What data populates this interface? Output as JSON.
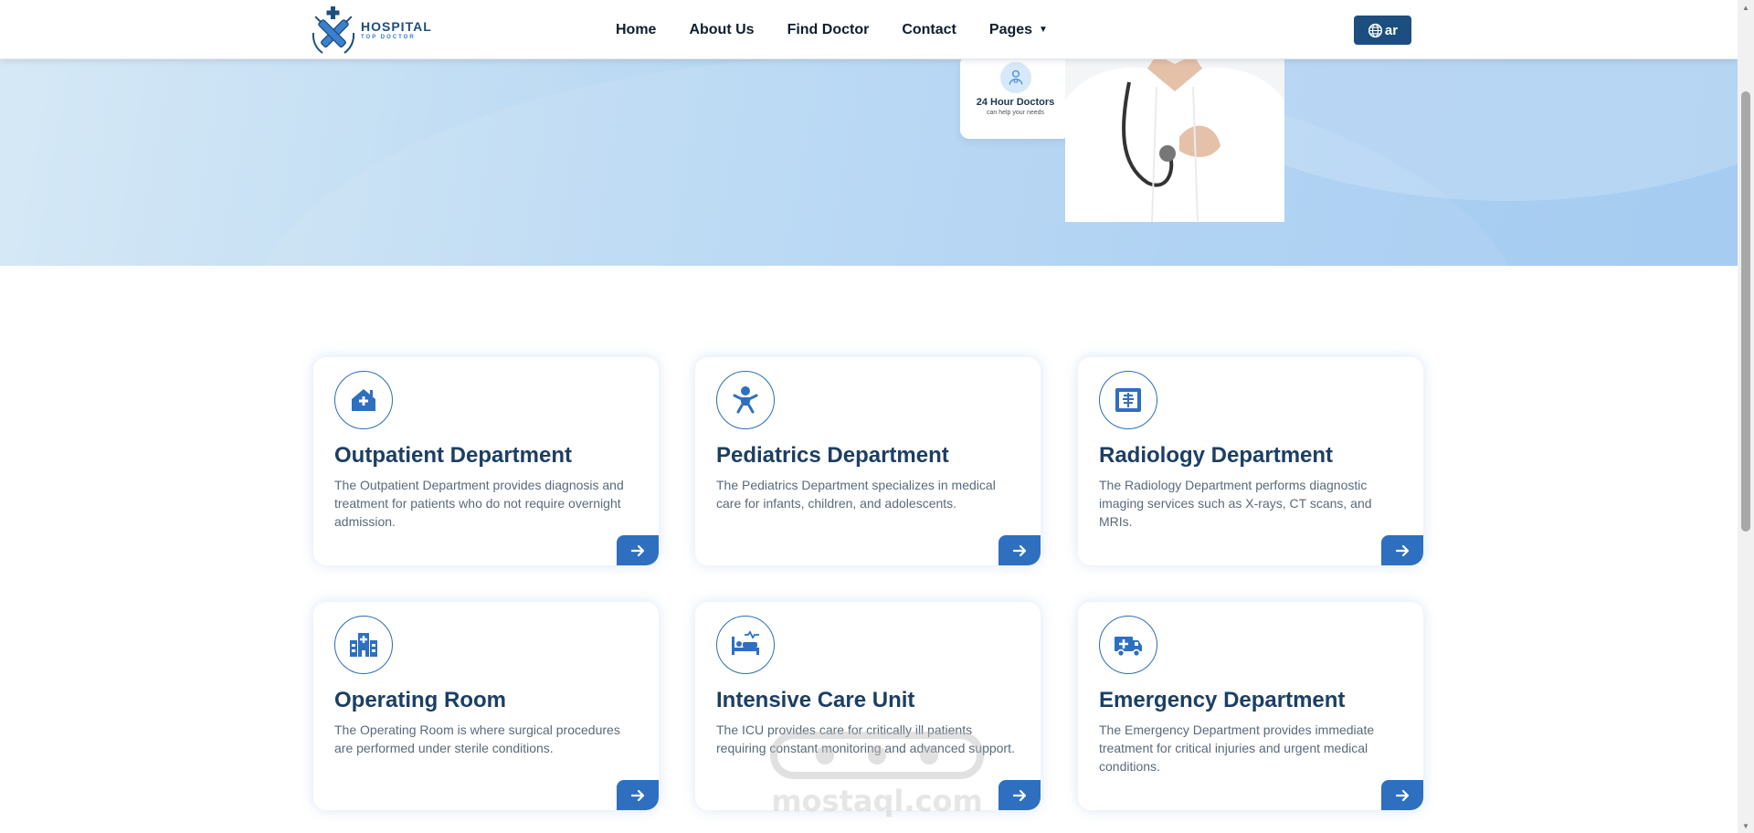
{
  "header": {
    "logo": {
      "line1": "HOSPITAL",
      "line2": "TOP DOCTOR"
    },
    "nav": [
      {
        "label": "Home"
      },
      {
        "label": "About Us"
      },
      {
        "label": "Find Doctor"
      },
      {
        "label": "Contact"
      },
      {
        "label": "Pages",
        "has_dropdown": true
      }
    ],
    "lang_button": {
      "label": "ar",
      "icon": "globe-icon"
    }
  },
  "hero": {
    "doc_card": {
      "title": "24 Hour Doctors",
      "subtitle": "can help your needs",
      "icon": "doctor-icon"
    }
  },
  "departments": [
    {
      "icon": "clinic-house-icon",
      "title": "Outpatient Department",
      "desc": "The Outpatient Department provides diagnosis and treatment for patients who do not require overnight admission."
    },
    {
      "icon": "baby-icon",
      "title": "Pediatrics Department",
      "desc": "The Pediatrics Department specializes in medical care for infants, children, and adolescents."
    },
    {
      "icon": "xray-icon",
      "title": "Radiology Department",
      "desc": "The Radiology Department performs diagnostic imaging services such as X-rays, CT scans, and MRIs."
    },
    {
      "icon": "hospital-building-icon",
      "title": "Operating Room",
      "desc": "The Operating Room is where surgical procedures are performed under sterile conditions."
    },
    {
      "icon": "hospital-bed-icon",
      "title": "Intensive Care Unit",
      "desc": "The ICU provides care for critically ill patients requiring constant monitoring and advanced support."
    },
    {
      "icon": "ambulance-icon",
      "title": "Emergency Department",
      "desc": "The Emergency Department provides immediate treatment for critical injuries and urgent medical conditions."
    }
  ],
  "watermark": {
    "text": "mostaql.com"
  },
  "colors": {
    "primary": "#2e6fc0",
    "dark_blue": "#1c4f80",
    "title": "#1c3f63",
    "hero_bg": "#aacff2"
  }
}
